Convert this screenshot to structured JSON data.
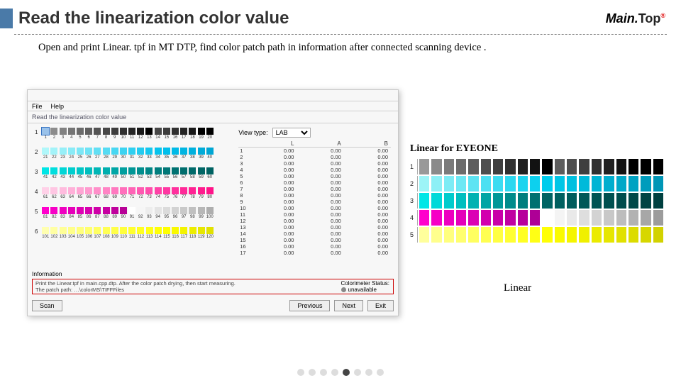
{
  "title": "Read the linearization color value",
  "brand": {
    "main": "Main.",
    "top": "Top"
  },
  "description": "Open and print Linear. tpf in MT DTP, find color patch path in information after connected scanning device .",
  "app": {
    "menu": {
      "file": "File",
      "help": "Help"
    },
    "windowTitle": "Read the linearization color value",
    "viewType": {
      "label": "View type:",
      "value": "LAB"
    },
    "labHeader": {
      "L": "L",
      "A": "A",
      "B": "B"
    },
    "labRows": [
      {
        "i": "1",
        "l": "0.00",
        "a": "0.00",
        "b": "0.00"
      },
      {
        "i": "2",
        "l": "0.00",
        "a": "0.00",
        "b": "0.00"
      },
      {
        "i": "3",
        "l": "0.00",
        "a": "0.00",
        "b": "0.00"
      },
      {
        "i": "4",
        "l": "0.00",
        "a": "0.00",
        "b": "0.00"
      },
      {
        "i": "5",
        "l": "0.00",
        "a": "0.00",
        "b": "0.00"
      },
      {
        "i": "6",
        "l": "0.00",
        "a": "0.00",
        "b": "0.00"
      },
      {
        "i": "7",
        "l": "0.00",
        "a": "0.00",
        "b": "0.00"
      },
      {
        "i": "8",
        "l": "0.00",
        "a": "0.00",
        "b": "0.00"
      },
      {
        "i": "9",
        "l": "0.00",
        "a": "0.00",
        "b": "0.00"
      },
      {
        "i": "10",
        "l": "0.00",
        "a": "0.00",
        "b": "0.00"
      },
      {
        "i": "11",
        "l": "0.00",
        "a": "0.00",
        "b": "0.00"
      },
      {
        "i": "12",
        "l": "0.00",
        "a": "0.00",
        "b": "0.00"
      },
      {
        "i": "13",
        "l": "0.00",
        "a": "0.00",
        "b": "0.00"
      },
      {
        "i": "14",
        "l": "0.00",
        "a": "0.00",
        "b": "0.00"
      },
      {
        "i": "15",
        "l": "0.00",
        "a": "0.00",
        "b": "0.00"
      },
      {
        "i": "16",
        "l": "0.00",
        "a": "0.00",
        "b": "0.00"
      },
      {
        "i": "17",
        "l": "0.00",
        "a": "0.00",
        "b": "0.00"
      }
    ],
    "info": {
      "label": "Information",
      "text1": "Print the Linear.tpf in main.cpp.dtp. After the color patch drying, then start measuring.",
      "text2": "The patch path: …\\colorMS\\TIFFFiles"
    },
    "colorimeter": {
      "label": "Colorimeter Status:",
      "status": "unavailable"
    },
    "buttons": {
      "scan": "Scan",
      "prev": "Previous",
      "next": "Next",
      "exit": "Exit"
    },
    "patchRows": [
      {
        "label": "1",
        "start": 1,
        "colors": [
          "#8c8c8c",
          "#8c8c8c",
          "#818181",
          "#757575",
          "#6a6a6a",
          "#5e5e5e",
          "#535353",
          "#474747",
          "#3c3c3c",
          "#303030",
          "#252525",
          "#191919",
          "#000000",
          "#474747",
          "#3c3c3c",
          "#303030",
          "#252525",
          "#191919",
          "#000000",
          "#000000"
        ],
        "selectedFirst": true
      },
      {
        "label": "2",
        "start": 21,
        "colors": [
          "#b0f7fa",
          "#a3f3f9",
          "#96eff8",
          "#89ebf7",
          "#7ce7f6",
          "#6fe3f5",
          "#62dff4",
          "#55dbf3",
          "#48d7f2",
          "#3bd3f1",
          "#2ecff0",
          "#21cbef",
          "#14c7ee",
          "#07c3ed",
          "#00bfec",
          "#00bae7",
          "#00b5e2",
          "#00b0dd",
          "#00abd8",
          "#00a6d3"
        ]
      },
      {
        "label": "3",
        "start": 41,
        "colors": [
          "#00e6e6",
          "#00dede",
          "#00d6d6",
          "#00cece",
          "#00c6c6",
          "#00bebe",
          "#00b6b6",
          "#00aeae",
          "#00a6a6",
          "#009e9e",
          "#009696",
          "#008e8e",
          "#008686",
          "#007e7e",
          "#007676",
          "#007272",
          "#006e6e",
          "#006a6a",
          "#006666",
          "#006262"
        ]
      },
      {
        "label": "4",
        "start": 61,
        "colors": [
          "#ffd1e8",
          "#ffc6e3",
          "#ffbbde",
          "#ffb0d9",
          "#ffa5d4",
          "#ff9acf",
          "#ff8fca",
          "#ff84c5",
          "#ff79c0",
          "#ff6ebb",
          "#ff63b6",
          "#ff58b1",
          "#ff4dac",
          "#ff42a7",
          "#ff37a2",
          "#ff309d",
          "#ff2998",
          "#ff2293",
          "#ff1b8e",
          "#ff1489"
        ]
      },
      {
        "label": "5",
        "start": 81,
        "colors": [
          "#ff00cc",
          "#f700c6",
          "#ef00c0",
          "#e700ba",
          "#df00b4",
          "#d700ae",
          "#cf00a8",
          "#c700a2",
          "#bf009c",
          "#b70096",
          "#ffffff",
          "#f6f6f6",
          "#ededed",
          "#e4e4e4",
          "#dbdbdb",
          "#d2d2d2",
          "#c9c9c9",
          "#c0c0c0",
          "#b7b7b7",
          "#aeaeae"
        ]
      },
      {
        "label": "6",
        "start": 101,
        "colors": [
          "#ffffb0",
          "#ffffa3",
          "#ffff96",
          "#ffff89",
          "#ffff7c",
          "#ffff6f",
          "#ffff62",
          "#ffff55",
          "#ffff48",
          "#ffff3b",
          "#ffff2e",
          "#ffff21",
          "#ffff14",
          "#ffff07",
          "#ffff00",
          "#f9f900",
          "#f3f300",
          "#eded00",
          "#e7e700",
          "#e1e100"
        ]
      }
    ]
  },
  "eyeone": {
    "title": "Linear for EYEONE",
    "rows": [
      {
        "label": "1",
        "colors": [
          "#999999",
          "#8a8a8a",
          "#7b7b7b",
          "#6c6c6c",
          "#5d5d5d",
          "#4e4e4e",
          "#3f3f3f",
          "#303030",
          "#212121",
          "#121212",
          "#000000",
          "#5d5d5d",
          "#4e4e4e",
          "#3f3f3f",
          "#303030",
          "#212121",
          "#121212",
          "#000000",
          "#000000",
          "#000000"
        ]
      },
      {
        "label": "2",
        "colors": [
          "#9df4f7",
          "#8df0f6",
          "#7decf5",
          "#6de8f4",
          "#5de4f3",
          "#4de0f2",
          "#3ddcf1",
          "#2dd8f0",
          "#1dd4ef",
          "#0dd0ee",
          "#00ccec",
          "#00c6e6",
          "#00c0e0",
          "#00bada",
          "#00b4d4",
          "#00aece",
          "#00a8c8",
          "#00a2c2",
          "#009cbc",
          "#0096b6"
        ]
      },
      {
        "label": "3",
        "colors": [
          "#00e6e6",
          "#00d9d9",
          "#00cccc",
          "#00bfbf",
          "#00b2b2",
          "#00a5a5",
          "#009898",
          "#008b8b",
          "#007e7e",
          "#007171",
          "#006464",
          "#006060",
          "#005c5c",
          "#005858",
          "#005454",
          "#005050",
          "#004c4c",
          "#004848",
          "#004444",
          "#004040"
        ]
      },
      {
        "label": "4",
        "colors": [
          "#ff00cc",
          "#f600c6",
          "#ed00c0",
          "#e400ba",
          "#db00b4",
          "#d200ae",
          "#c900a8",
          "#c000a2",
          "#b7009c",
          "#ae0096",
          "#ffffff",
          "#f4f4f4",
          "#e9e9e9",
          "#dedede",
          "#d3d3d3",
          "#c8c8c8",
          "#bdbdbd",
          "#b2b2b2",
          "#a7a7a7",
          "#9c9c9c"
        ]
      },
      {
        "label": "5",
        "colors": [
          "#ffff9c",
          "#ffff8d",
          "#ffff7e",
          "#ffff6f",
          "#ffff60",
          "#ffff51",
          "#ffff42",
          "#ffff33",
          "#ffff24",
          "#ffff15",
          "#ffff06",
          "#fafa00",
          "#f5f500",
          "#f0f000",
          "#ebeb00",
          "#e6e600",
          "#e1e100",
          "#dcdc00",
          "#d7d700",
          "#d2d200"
        ]
      }
    ]
  },
  "linearLabel": "Linear"
}
